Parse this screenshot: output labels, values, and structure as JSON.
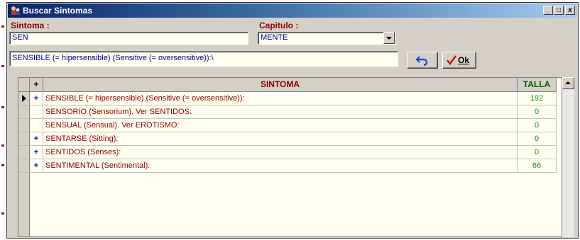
{
  "window": {
    "title": "Buscar Sintomas",
    "minimize": "_",
    "maximize": "□",
    "close": "x"
  },
  "form": {
    "sintoma_label": "Sintoma :",
    "sintoma_value": "SEN",
    "capitulo_label": "Capitulo :",
    "capitulo_value": "MENTE",
    "result_value": "SENSIBLE (= hipersensible) (Sensitive (= oversensitive)):\\"
  },
  "buttons": {
    "ok_label": "Ok"
  },
  "grid": {
    "columns": {
      "plus": "+",
      "sintoma": "SINTOMA",
      "talla": "TALLA"
    },
    "rows": [
      {
        "plus": "+",
        "sintoma": "SENSIBLE (= hipersensible) (Sensitive (= oversensitive)):",
        "talla": "192",
        "current": true
      },
      {
        "plus": "",
        "sintoma": "SENSORIO (Sensorium). Ver SENTIDOS:",
        "talla": "0",
        "current": false
      },
      {
        "plus": "",
        "sintoma": "SENSUAL (Sensual). Ver EROTISMO:",
        "talla": "0",
        "current": false
      },
      {
        "plus": "+",
        "sintoma": "SENTARSE (Sitting):",
        "talla": "0",
        "current": false
      },
      {
        "plus": "+",
        "sintoma": "SENTIDOS (Senses):",
        "talla": "0",
        "current": false
      },
      {
        "plus": "+",
        "sintoma": "SENTIMENTAL (Sentimental):",
        "talla": "66",
        "current": false
      }
    ]
  }
}
